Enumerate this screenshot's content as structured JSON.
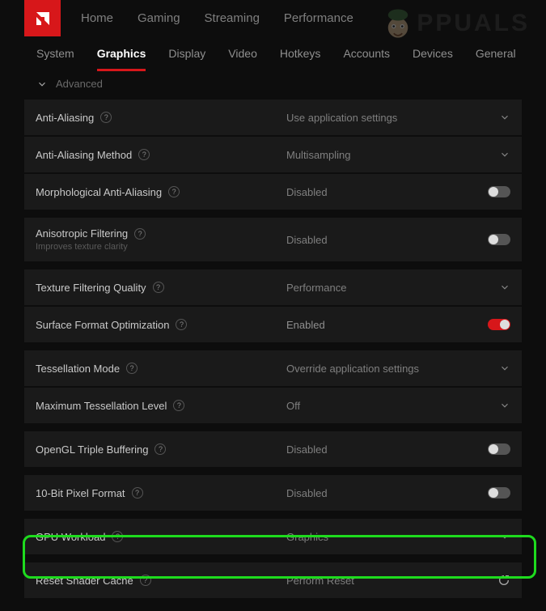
{
  "topnav": {
    "items": [
      "Home",
      "Gaming",
      "Streaming",
      "Performance"
    ]
  },
  "subnav": {
    "items": [
      "System",
      "Graphics",
      "Display",
      "Video",
      "Hotkeys",
      "Accounts",
      "Devices",
      "General"
    ],
    "active_index": 1
  },
  "section": {
    "label": "Advanced"
  },
  "settings": [
    {
      "label": "Anti-Aliasing",
      "value": "Use application settings",
      "control": "dropdown"
    },
    {
      "label": "Anti-Aliasing Method",
      "value": "Multisampling",
      "control": "dropdown"
    },
    {
      "label": "Morphological Anti-Aliasing",
      "value": "Disabled",
      "control": "toggle",
      "state": "off"
    },
    {
      "label": "Anisotropic Filtering",
      "sub": "Improves texture clarity",
      "value": "Disabled",
      "control": "toggle",
      "state": "off",
      "gap_before": true
    },
    {
      "label": "Texture Filtering Quality",
      "value": "Performance",
      "control": "dropdown",
      "gap_before": true
    },
    {
      "label": "Surface Format Optimization",
      "value": "Enabled",
      "control": "toggle",
      "state": "on"
    },
    {
      "label": "Tessellation Mode",
      "value": "Override application settings",
      "control": "dropdown",
      "gap_before": true
    },
    {
      "label": "Maximum Tessellation Level",
      "value": "Off",
      "control": "dropdown"
    },
    {
      "label": "OpenGL Triple Buffering",
      "value": "Disabled",
      "control": "toggle",
      "state": "off",
      "gap_before": true
    },
    {
      "label": "10-Bit Pixel Format",
      "value": "Disabled",
      "control": "toggle",
      "state": "off",
      "gap_before": true
    },
    {
      "label": "GPU Workload",
      "value": "Graphics",
      "control": "dropdown",
      "gap_before": true
    },
    {
      "label": "Reset Shader Cache",
      "value": "Perform Reset",
      "control": "reset",
      "gap_before": true
    }
  ],
  "watermark": {
    "text": "PPUALS"
  }
}
